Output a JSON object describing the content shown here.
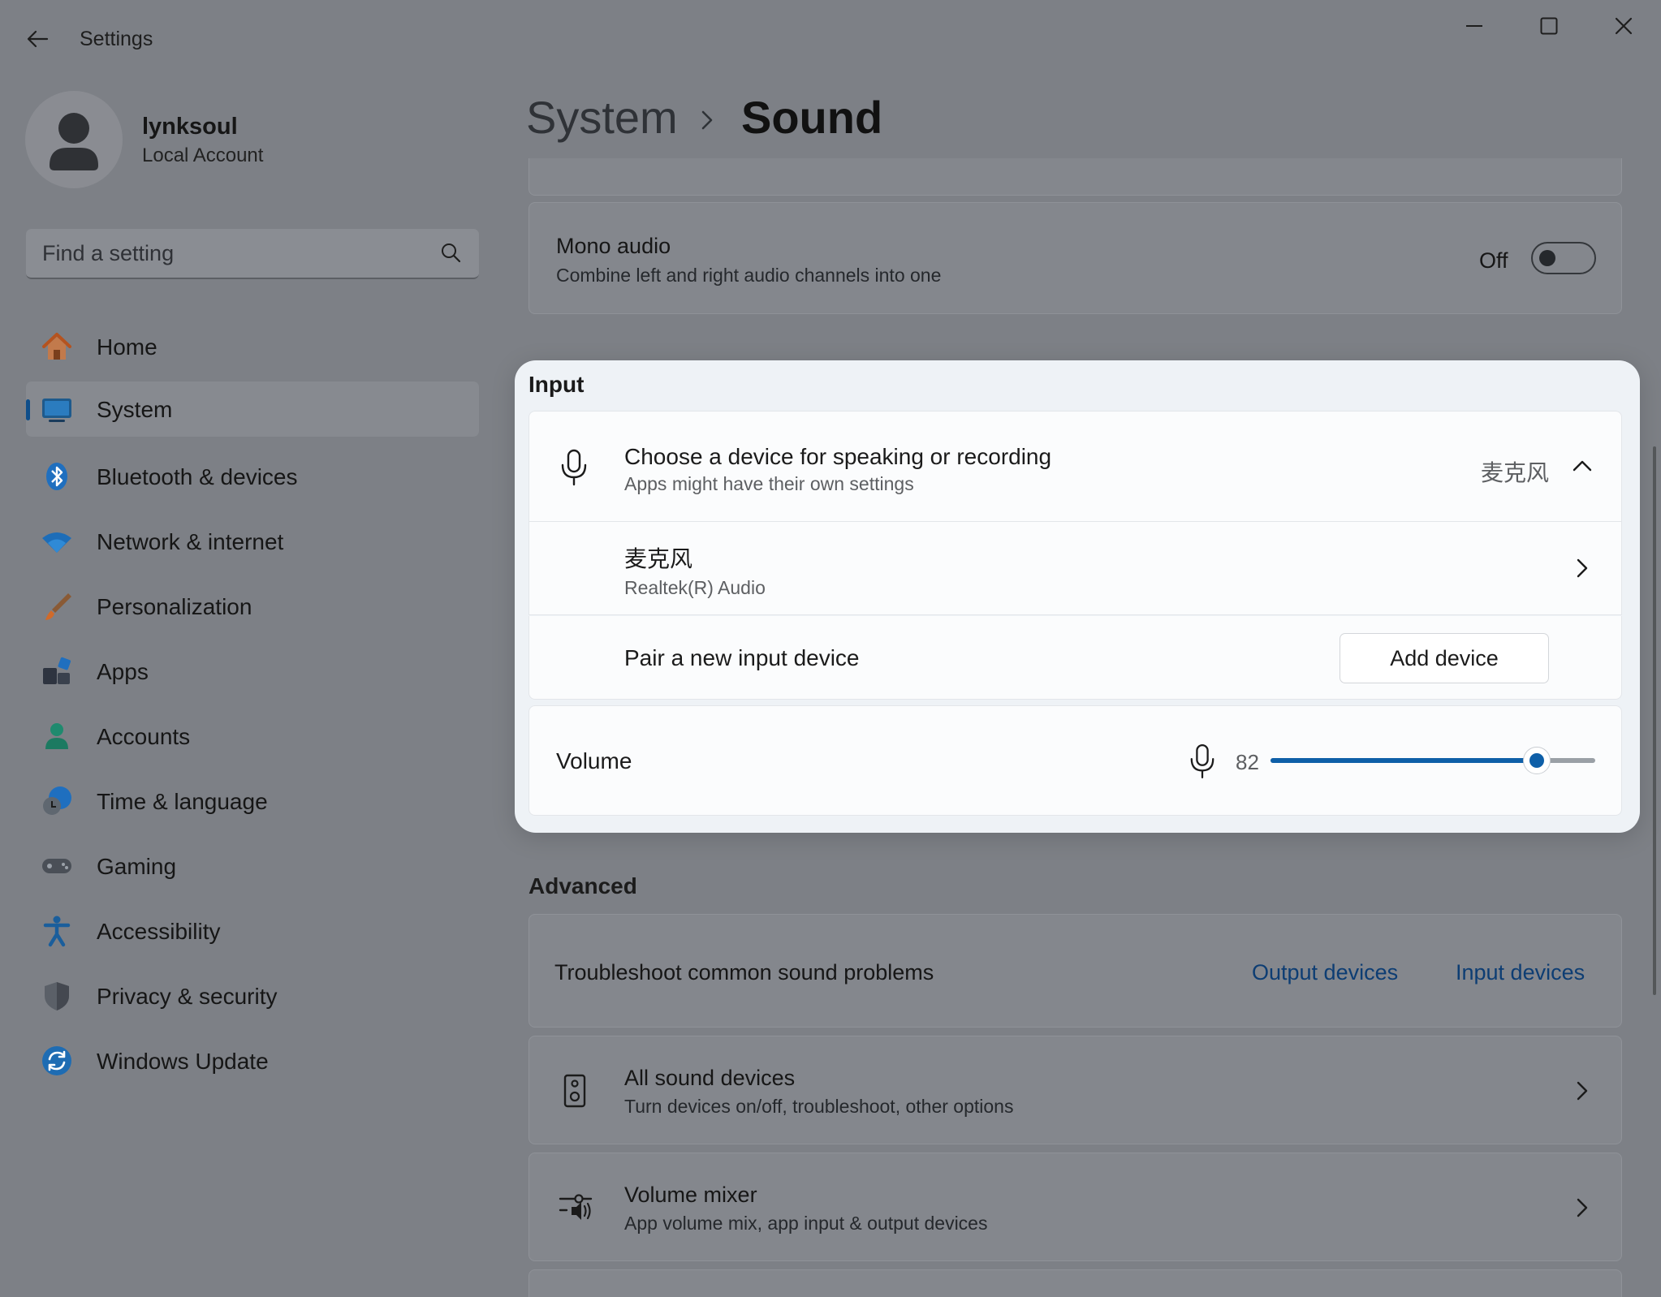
{
  "window": {
    "title": "Settings",
    "back_icon": "back-arrow-icon",
    "controls": [
      "minimize-icon",
      "maximize-icon",
      "close-icon"
    ]
  },
  "profile": {
    "name": "lynksoul",
    "account_type": "Local Account"
  },
  "search": {
    "placeholder": "Find a setting",
    "value": ""
  },
  "nav": {
    "items": [
      {
        "label": "Home",
        "icon": "home-icon"
      },
      {
        "label": "System",
        "icon": "system-icon",
        "active": true
      },
      {
        "label": "Bluetooth & devices",
        "icon": "bluetooth-icon"
      },
      {
        "label": "Network & internet",
        "icon": "wifi-icon"
      },
      {
        "label": "Personalization",
        "icon": "brush-icon"
      },
      {
        "label": "Apps",
        "icon": "apps-icon"
      },
      {
        "label": "Accounts",
        "icon": "accounts-icon"
      },
      {
        "label": "Time & language",
        "icon": "time-language-icon"
      },
      {
        "label": "Gaming",
        "icon": "gaming-icon"
      },
      {
        "label": "Accessibility",
        "icon": "accessibility-icon"
      },
      {
        "label": "Privacy & security",
        "icon": "shield-icon"
      },
      {
        "label": "Windows Update",
        "icon": "update-icon"
      }
    ]
  },
  "breadcrumb": {
    "parent": "System",
    "current": "Sound"
  },
  "mono_audio": {
    "title": "Mono audio",
    "description": "Combine left and right audio channels into one",
    "state_label": "Off",
    "enabled": false
  },
  "input": {
    "heading": "Input",
    "choose_device": {
      "title": "Choose a device for speaking or recording",
      "description": "Apps might have their own settings",
      "selected": "麦克风"
    },
    "device": {
      "name": "麦克风",
      "driver": "Realtek(R) Audio"
    },
    "pair": {
      "label": "Pair a new input device",
      "button": "Add device"
    },
    "volume": {
      "label": "Volume",
      "value": "82",
      "level": 0.82
    }
  },
  "advanced": {
    "heading": "Advanced",
    "troubleshoot": {
      "label": "Troubleshoot common sound problems",
      "output_link": "Output devices",
      "input_link": "Input devices"
    },
    "all_devices": {
      "title": "All sound devices",
      "description": "Turn devices on/off, troubleshoot, other options"
    },
    "mixer": {
      "title": "Volume mixer",
      "description": "App volume mix, app input & output devices"
    }
  },
  "colors": {
    "accent": "#0e5fa8",
    "link": "#0d3d73",
    "dim_background": "#7d8086"
  }
}
